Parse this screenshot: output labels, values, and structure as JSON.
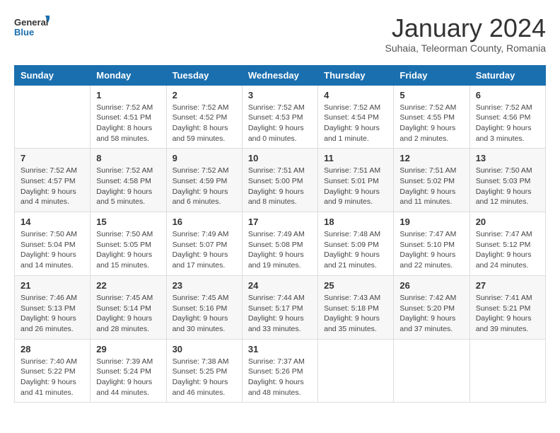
{
  "header": {
    "logo_text_general": "General",
    "logo_text_blue": "Blue",
    "month_title": "January 2024",
    "location": "Suhaia, Teleorman County, Romania"
  },
  "weekdays": [
    "Sunday",
    "Monday",
    "Tuesday",
    "Wednesday",
    "Thursday",
    "Friday",
    "Saturday"
  ],
  "weeks": [
    [
      {
        "day": "",
        "info": ""
      },
      {
        "day": "1",
        "info": "Sunrise: 7:52 AM\nSunset: 4:51 PM\nDaylight: 8 hours\nand 58 minutes."
      },
      {
        "day": "2",
        "info": "Sunrise: 7:52 AM\nSunset: 4:52 PM\nDaylight: 8 hours\nand 59 minutes."
      },
      {
        "day": "3",
        "info": "Sunrise: 7:52 AM\nSunset: 4:53 PM\nDaylight: 9 hours\nand 0 minutes."
      },
      {
        "day": "4",
        "info": "Sunrise: 7:52 AM\nSunset: 4:54 PM\nDaylight: 9 hours\nand 1 minute."
      },
      {
        "day": "5",
        "info": "Sunrise: 7:52 AM\nSunset: 4:55 PM\nDaylight: 9 hours\nand 2 minutes."
      },
      {
        "day": "6",
        "info": "Sunrise: 7:52 AM\nSunset: 4:56 PM\nDaylight: 9 hours\nand 3 minutes."
      }
    ],
    [
      {
        "day": "7",
        "info": "Sunrise: 7:52 AM\nSunset: 4:57 PM\nDaylight: 9 hours\nand 4 minutes."
      },
      {
        "day": "8",
        "info": "Sunrise: 7:52 AM\nSunset: 4:58 PM\nDaylight: 9 hours\nand 5 minutes."
      },
      {
        "day": "9",
        "info": "Sunrise: 7:52 AM\nSunset: 4:59 PM\nDaylight: 9 hours\nand 6 minutes."
      },
      {
        "day": "10",
        "info": "Sunrise: 7:51 AM\nSunset: 5:00 PM\nDaylight: 9 hours\nand 8 minutes."
      },
      {
        "day": "11",
        "info": "Sunrise: 7:51 AM\nSunset: 5:01 PM\nDaylight: 9 hours\nand 9 minutes."
      },
      {
        "day": "12",
        "info": "Sunrise: 7:51 AM\nSunset: 5:02 PM\nDaylight: 9 hours\nand 11 minutes."
      },
      {
        "day": "13",
        "info": "Sunrise: 7:50 AM\nSunset: 5:03 PM\nDaylight: 9 hours\nand 12 minutes."
      }
    ],
    [
      {
        "day": "14",
        "info": "Sunrise: 7:50 AM\nSunset: 5:04 PM\nDaylight: 9 hours\nand 14 minutes."
      },
      {
        "day": "15",
        "info": "Sunrise: 7:50 AM\nSunset: 5:05 PM\nDaylight: 9 hours\nand 15 minutes."
      },
      {
        "day": "16",
        "info": "Sunrise: 7:49 AM\nSunset: 5:07 PM\nDaylight: 9 hours\nand 17 minutes."
      },
      {
        "day": "17",
        "info": "Sunrise: 7:49 AM\nSunset: 5:08 PM\nDaylight: 9 hours\nand 19 minutes."
      },
      {
        "day": "18",
        "info": "Sunrise: 7:48 AM\nSunset: 5:09 PM\nDaylight: 9 hours\nand 21 minutes."
      },
      {
        "day": "19",
        "info": "Sunrise: 7:47 AM\nSunset: 5:10 PM\nDaylight: 9 hours\nand 22 minutes."
      },
      {
        "day": "20",
        "info": "Sunrise: 7:47 AM\nSunset: 5:12 PM\nDaylight: 9 hours\nand 24 minutes."
      }
    ],
    [
      {
        "day": "21",
        "info": "Sunrise: 7:46 AM\nSunset: 5:13 PM\nDaylight: 9 hours\nand 26 minutes."
      },
      {
        "day": "22",
        "info": "Sunrise: 7:45 AM\nSunset: 5:14 PM\nDaylight: 9 hours\nand 28 minutes."
      },
      {
        "day": "23",
        "info": "Sunrise: 7:45 AM\nSunset: 5:16 PM\nDaylight: 9 hours\nand 30 minutes."
      },
      {
        "day": "24",
        "info": "Sunrise: 7:44 AM\nSunset: 5:17 PM\nDaylight: 9 hours\nand 33 minutes."
      },
      {
        "day": "25",
        "info": "Sunrise: 7:43 AM\nSunset: 5:18 PM\nDaylight: 9 hours\nand 35 minutes."
      },
      {
        "day": "26",
        "info": "Sunrise: 7:42 AM\nSunset: 5:20 PM\nDaylight: 9 hours\nand 37 minutes."
      },
      {
        "day": "27",
        "info": "Sunrise: 7:41 AM\nSunset: 5:21 PM\nDaylight: 9 hours\nand 39 minutes."
      }
    ],
    [
      {
        "day": "28",
        "info": "Sunrise: 7:40 AM\nSunset: 5:22 PM\nDaylight: 9 hours\nand 41 minutes."
      },
      {
        "day": "29",
        "info": "Sunrise: 7:39 AM\nSunset: 5:24 PM\nDaylight: 9 hours\nand 44 minutes."
      },
      {
        "day": "30",
        "info": "Sunrise: 7:38 AM\nSunset: 5:25 PM\nDaylight: 9 hours\nand 46 minutes."
      },
      {
        "day": "31",
        "info": "Sunrise: 7:37 AM\nSunset: 5:26 PM\nDaylight: 9 hours\nand 48 minutes."
      },
      {
        "day": "",
        "info": ""
      },
      {
        "day": "",
        "info": ""
      },
      {
        "day": "",
        "info": ""
      }
    ]
  ]
}
